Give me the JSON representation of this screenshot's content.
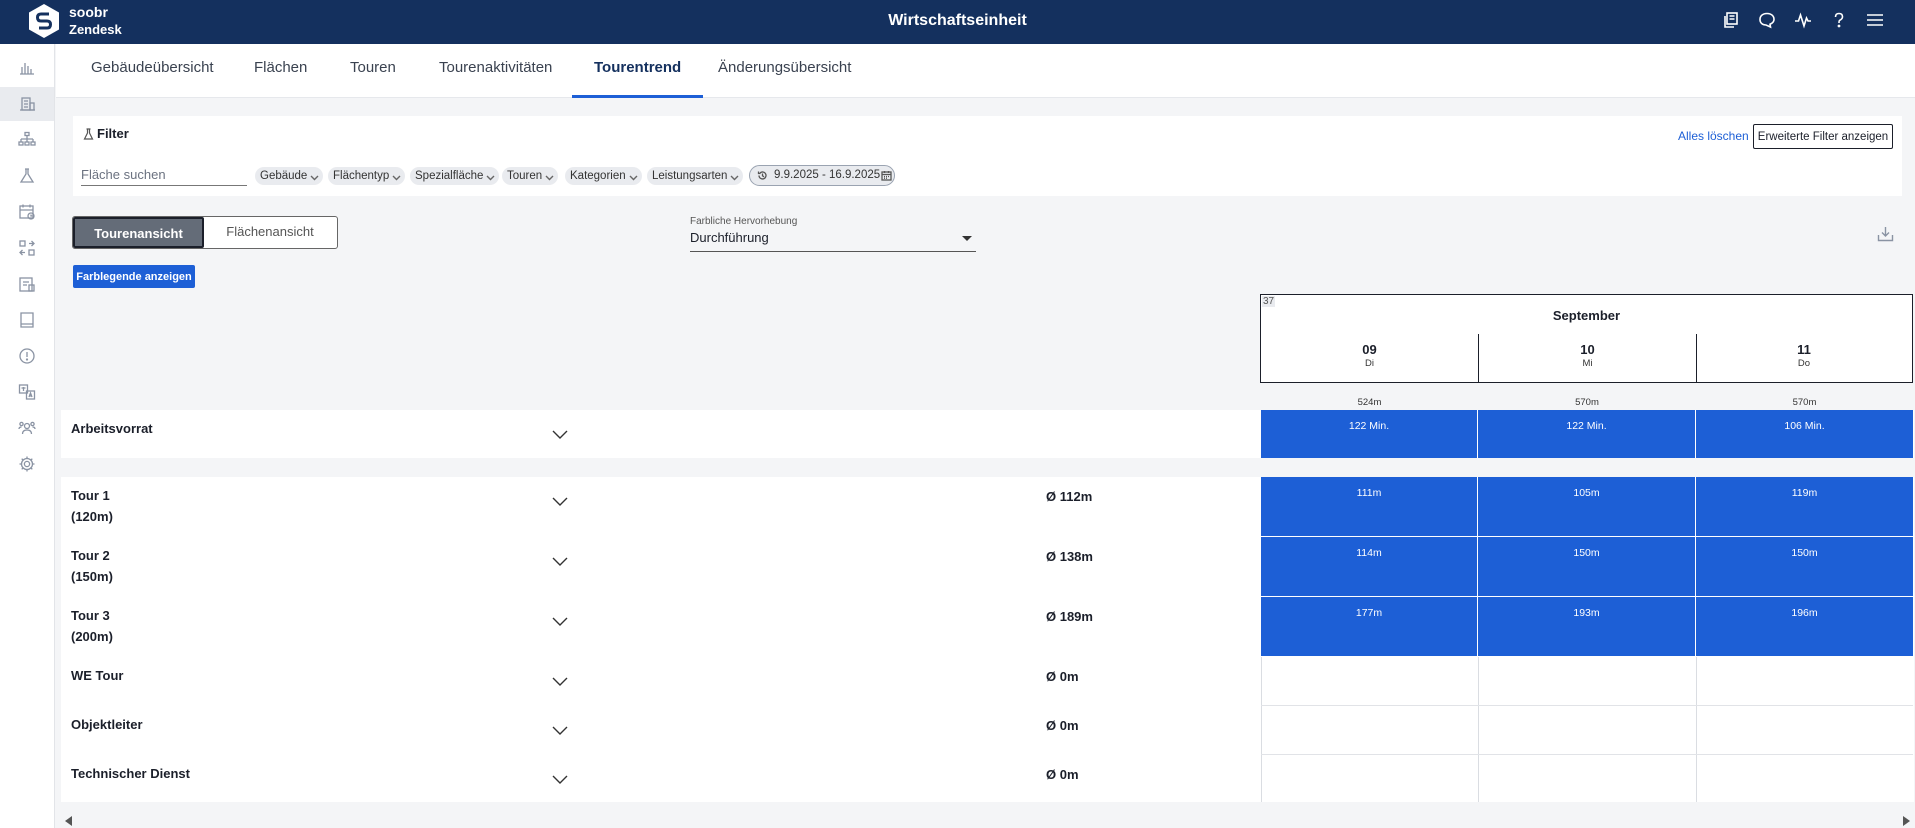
{
  "brand": {
    "name": "soobr",
    "sub": "Zendesk"
  },
  "app_title": "Wirtschaftseinheit",
  "top_icons": [
    "copy-icon",
    "chat-icon",
    "activity-icon",
    "help-icon",
    "menu-icon"
  ],
  "tabs": [
    {
      "label": "Gebäudeübersicht",
      "active": false
    },
    {
      "label": "Flächen",
      "active": false
    },
    {
      "label": "Touren",
      "active": false
    },
    {
      "label": "Tourenaktivitäten",
      "active": false
    },
    {
      "label": "Tourentrend",
      "active": true
    },
    {
      "label": "Änderungsübersicht",
      "active": false
    }
  ],
  "filter": {
    "title": "Filter",
    "clear_all": "Alles löschen",
    "advanced": "Erweiterte Filter anzeigen",
    "search_placeholder": "Fläche suchen",
    "chips": [
      "Gebäude",
      "Flächentyp",
      "Spezialfläche",
      "Touren",
      "Kategorien",
      "Leistungsarten"
    ],
    "date_range": "9.9.2025 - 16.9.2025"
  },
  "view_toggle": {
    "tour_view": "Tourenansicht",
    "area_view": "Flächenansicht",
    "selected": "Tourenansicht"
  },
  "legend_button": "Farblegende anzeigen",
  "highlight": {
    "label": "Farbliche Hervorhebung",
    "value": "Durchführung"
  },
  "calendar": {
    "week": "37",
    "month": "September",
    "days": [
      {
        "num": "09",
        "weekday": "Di",
        "total": "524m"
      },
      {
        "num": "10",
        "weekday": "Mi",
        "total": "570m"
      },
      {
        "num": "11",
        "weekday": "Do",
        "total": "570m"
      }
    ]
  },
  "backlog": {
    "name": "Arbeitsvorrat",
    "values": [
      "122 Min.",
      "122 Min.",
      "106 Min."
    ]
  },
  "tours": [
    {
      "name": "Tour 1",
      "planned": "(120m)",
      "avg": "Ø 112m",
      "values": [
        "111m",
        "105m",
        "119m"
      ]
    },
    {
      "name": "Tour 2",
      "planned": "(150m)",
      "avg": "Ø 138m",
      "values": [
        "114m",
        "150m",
        "150m"
      ]
    },
    {
      "name": "Tour 3",
      "planned": "(200m)",
      "avg": "Ø 189m",
      "values": [
        "177m",
        "193m",
        "196m"
      ]
    },
    {
      "name": "WE Tour",
      "planned": "",
      "avg": "Ø 0m",
      "values": [
        "",
        "",
        ""
      ]
    },
    {
      "name": "Objektleiter",
      "planned": "",
      "avg": "Ø 0m",
      "values": [
        "",
        "",
        ""
      ]
    },
    {
      "name": "Technischer Dienst",
      "planned": "",
      "avg": "Ø 0m",
      "values": [
        "",
        "",
        ""
      ]
    }
  ],
  "colors": {
    "header": "#14305e",
    "accent": "#1d5fd6"
  }
}
